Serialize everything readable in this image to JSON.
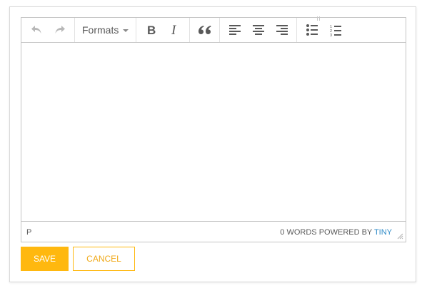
{
  "toolbar": {
    "undo_icon": "undo-icon",
    "redo_icon": "redo-icon",
    "formats_label": "Formats",
    "bold_icon": "bold-icon",
    "italic_icon": "italic-icon",
    "blockquote_icon": "blockquote-icon",
    "align_left_icon": "align-left-icon",
    "align_center_icon": "align-center-icon",
    "align_right_icon": "align-right-icon",
    "bullet_list_icon": "bullet-list-icon",
    "numbered_list_icon": "numbered-list-icon"
  },
  "editor": {
    "content": ""
  },
  "statusbar": {
    "path": "P",
    "word_count": "0 WORDS",
    "powered_by": "POWERED BY",
    "brand": "TINY"
  },
  "actions": {
    "save_label": "SAVE",
    "cancel_label": "CANCEL"
  },
  "colors": {
    "accent": "#ffb80f",
    "brand_link": "#2d8ac7",
    "icon": "#595959",
    "icon_disabled": "#b8b8b8",
    "border": "#c5c5c5"
  }
}
